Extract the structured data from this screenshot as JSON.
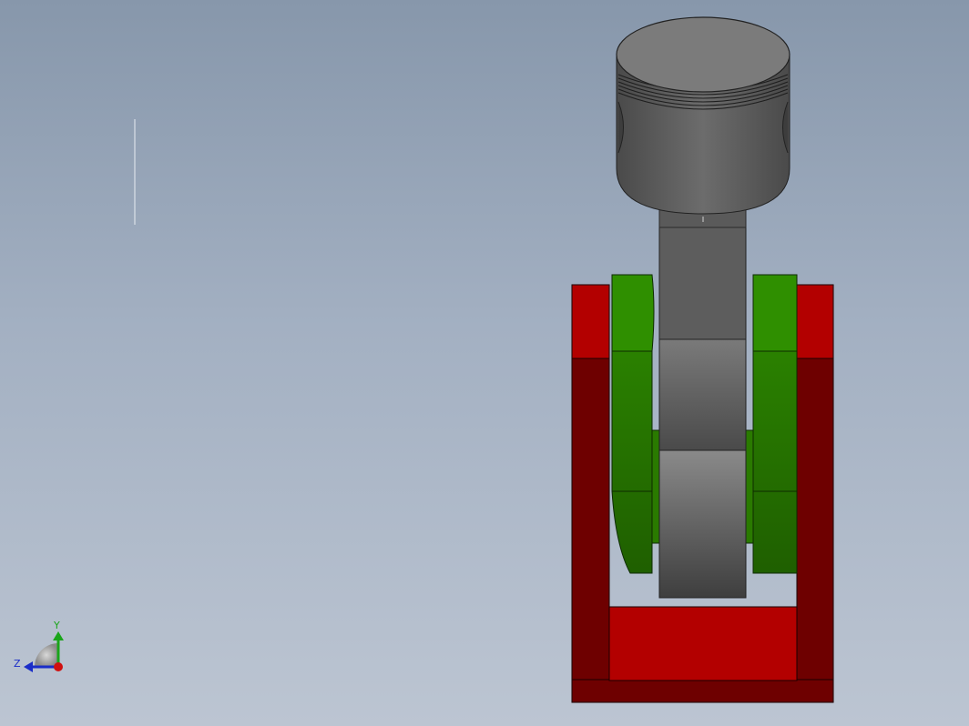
{
  "viewport": {
    "background_top": "#8797ab",
    "background_bottom": "#bcc5d2"
  },
  "model": {
    "parts": [
      {
        "name": "piston",
        "color": "#6a6a6a"
      },
      {
        "name": "connecting-rod",
        "color": "#5e5e5e"
      },
      {
        "name": "crankshaft",
        "color": "#2f8a00"
      },
      {
        "name": "frame",
        "color": "#b00000"
      }
    ]
  },
  "triad": {
    "y_label": "Y",
    "z_label": "Z",
    "y_color": "#1aa51a",
    "z_color": "#1a2dc8",
    "x_color": "#d01010"
  }
}
